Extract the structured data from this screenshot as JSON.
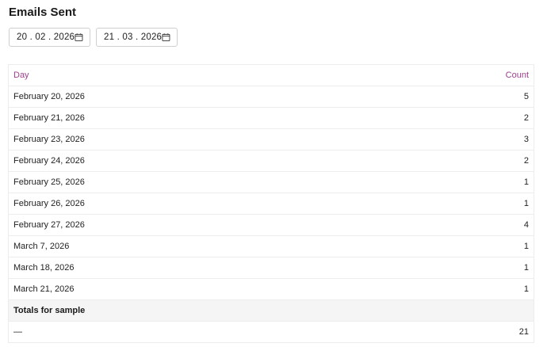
{
  "page": {
    "title": "Emails Sent"
  },
  "filters": {
    "start_date": "20 . 02 . 2026",
    "end_date": "21 . 03 . 2026",
    "calendar_icon": "calendar-icon"
  },
  "table": {
    "columns": {
      "day": "Day",
      "count": "Count"
    },
    "rows": [
      {
        "day": "February 20, 2026",
        "count": "5"
      },
      {
        "day": "February 21, 2026",
        "count": "2"
      },
      {
        "day": "February 23, 2026",
        "count": "3"
      },
      {
        "day": "February 24, 2026",
        "count": "2"
      },
      {
        "day": "February 25, 2026",
        "count": "1"
      },
      {
        "day": "February 26, 2026",
        "count": "1"
      },
      {
        "day": "February 27, 2026",
        "count": "4"
      },
      {
        "day": "March 7, 2026",
        "count": "1"
      },
      {
        "day": "March 18, 2026",
        "count": "1"
      },
      {
        "day": "March 21, 2026",
        "count": "1"
      }
    ],
    "totals": {
      "label": "Totals for sample",
      "day": "—",
      "count": "21"
    }
  },
  "colors": {
    "header_text": "#9c3f8c",
    "totals_background": "#f5f5f5",
    "border": "#ededed"
  }
}
